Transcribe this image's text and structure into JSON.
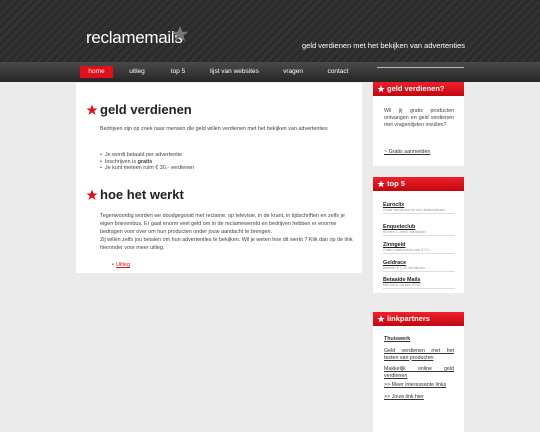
{
  "header": {
    "logo_text": "reclamemails",
    "tagline": "geld verdienen met het bekijken van advertenties"
  },
  "nav": {
    "items": [
      {
        "label": "home",
        "active": true
      },
      {
        "label": "uitleg",
        "active": false
      },
      {
        "label": "top 5",
        "active": false
      },
      {
        "label": "lijst van websites",
        "active": false
      },
      {
        "label": "vragen",
        "active": false
      },
      {
        "label": "contact",
        "active": false
      }
    ]
  },
  "main": {
    "section1": {
      "title": "geld verdienen",
      "intro": "Bedrijven zijn op zoek naar mensen die geld willen verdienen met het bekijken van advertenties",
      "bullets": [
        "Je wordt betaald per advertentie",
        "Inschrijven is",
        "Je kunt meteen ruim € 30,- verdienen"
      ],
      "bullet2_bold": "gratis"
    },
    "section2": {
      "title": "hoe het werkt",
      "para1": "Tegenwoordig worden we doodgegooid met reclame: op televisie, in de krant, in tijdschriften en zelfs je eigen brievenbus. Er gaat enorm veel geld om in de reclamewereld en bedrijven hebben er enorme bedragen voor over om hun producten onder jouw aandacht te brengen.",
      "para2": "Zij willen zelfs jou betalen om hun advertenties te bekijken. Wil je weten hoe dit werkt ? Klik dan op de link hieronder voor meer uitleg.",
      "link": "Uitleg"
    }
  },
  "sidebar": {
    "box1": {
      "title": "geld verdienen?",
      "text": "Wil jij gratis producten ontvangen en geld verdienen met vragenlijsten invullen?",
      "link": "~ Gratis aanmelden"
    },
    "box2": {
      "title": "top 5",
      "items": [
        {
          "name": "Euroclix",
          "desc": "Goed verdienen en een betrouwbaar"
        },
        {
          "name": "Enqueteclub",
          "desc": "Binnen 1 week uitbetaald"
        },
        {
          "name": "Zinngeld",
          "desc": "Gratis cadeaubon van € 10,-"
        },
        {
          "name": "Geldrace",
          "desc": "Meteen € 1,25 verdienen"
        },
        {
          "name": "Betaalde Mails",
          "desc": "Met kans op een iPod"
        }
      ]
    },
    "box3": {
      "title": "linkpartners",
      "links": [
        "Thuiswerk",
        "Geld verdienen met het testen van producten",
        "Makkelijk online geld verdienen",
        ">> Meer interessante links",
        ">> Jouw link hier"
      ]
    }
  }
}
